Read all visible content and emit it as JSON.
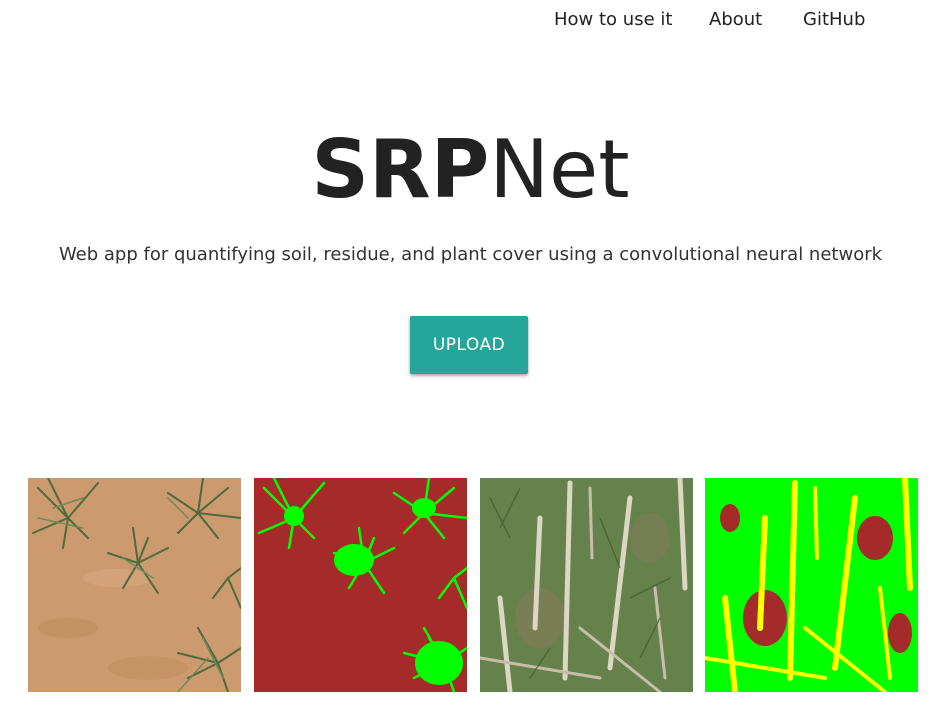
{
  "nav": {
    "items": [
      {
        "label": "How to use it"
      },
      {
        "label": "About"
      },
      {
        "label": "GitHub"
      }
    ]
  },
  "hero": {
    "title_bold": "SRP",
    "title_light": "Net",
    "subtitle": "Web app for quantifying soil, residue, and plant cover using a convolutional neural network"
  },
  "upload": {
    "label": "UPLOAD"
  },
  "colors": {
    "accent": "#26a69a",
    "soil_class": "#a52a2a",
    "plant_class": "#00ff00",
    "residue_class": "#ffff00",
    "soil_photo": "#c9966a"
  },
  "gallery": {
    "images": [
      {
        "kind": "photo",
        "subject": "wheat seedlings on bare soil"
      },
      {
        "kind": "segmentation",
        "subject": "soil and plant mask"
      },
      {
        "kind": "photo",
        "subject": "plants with crop residue"
      },
      {
        "kind": "segmentation",
        "subject": "soil, residue and plant mask"
      }
    ]
  }
}
